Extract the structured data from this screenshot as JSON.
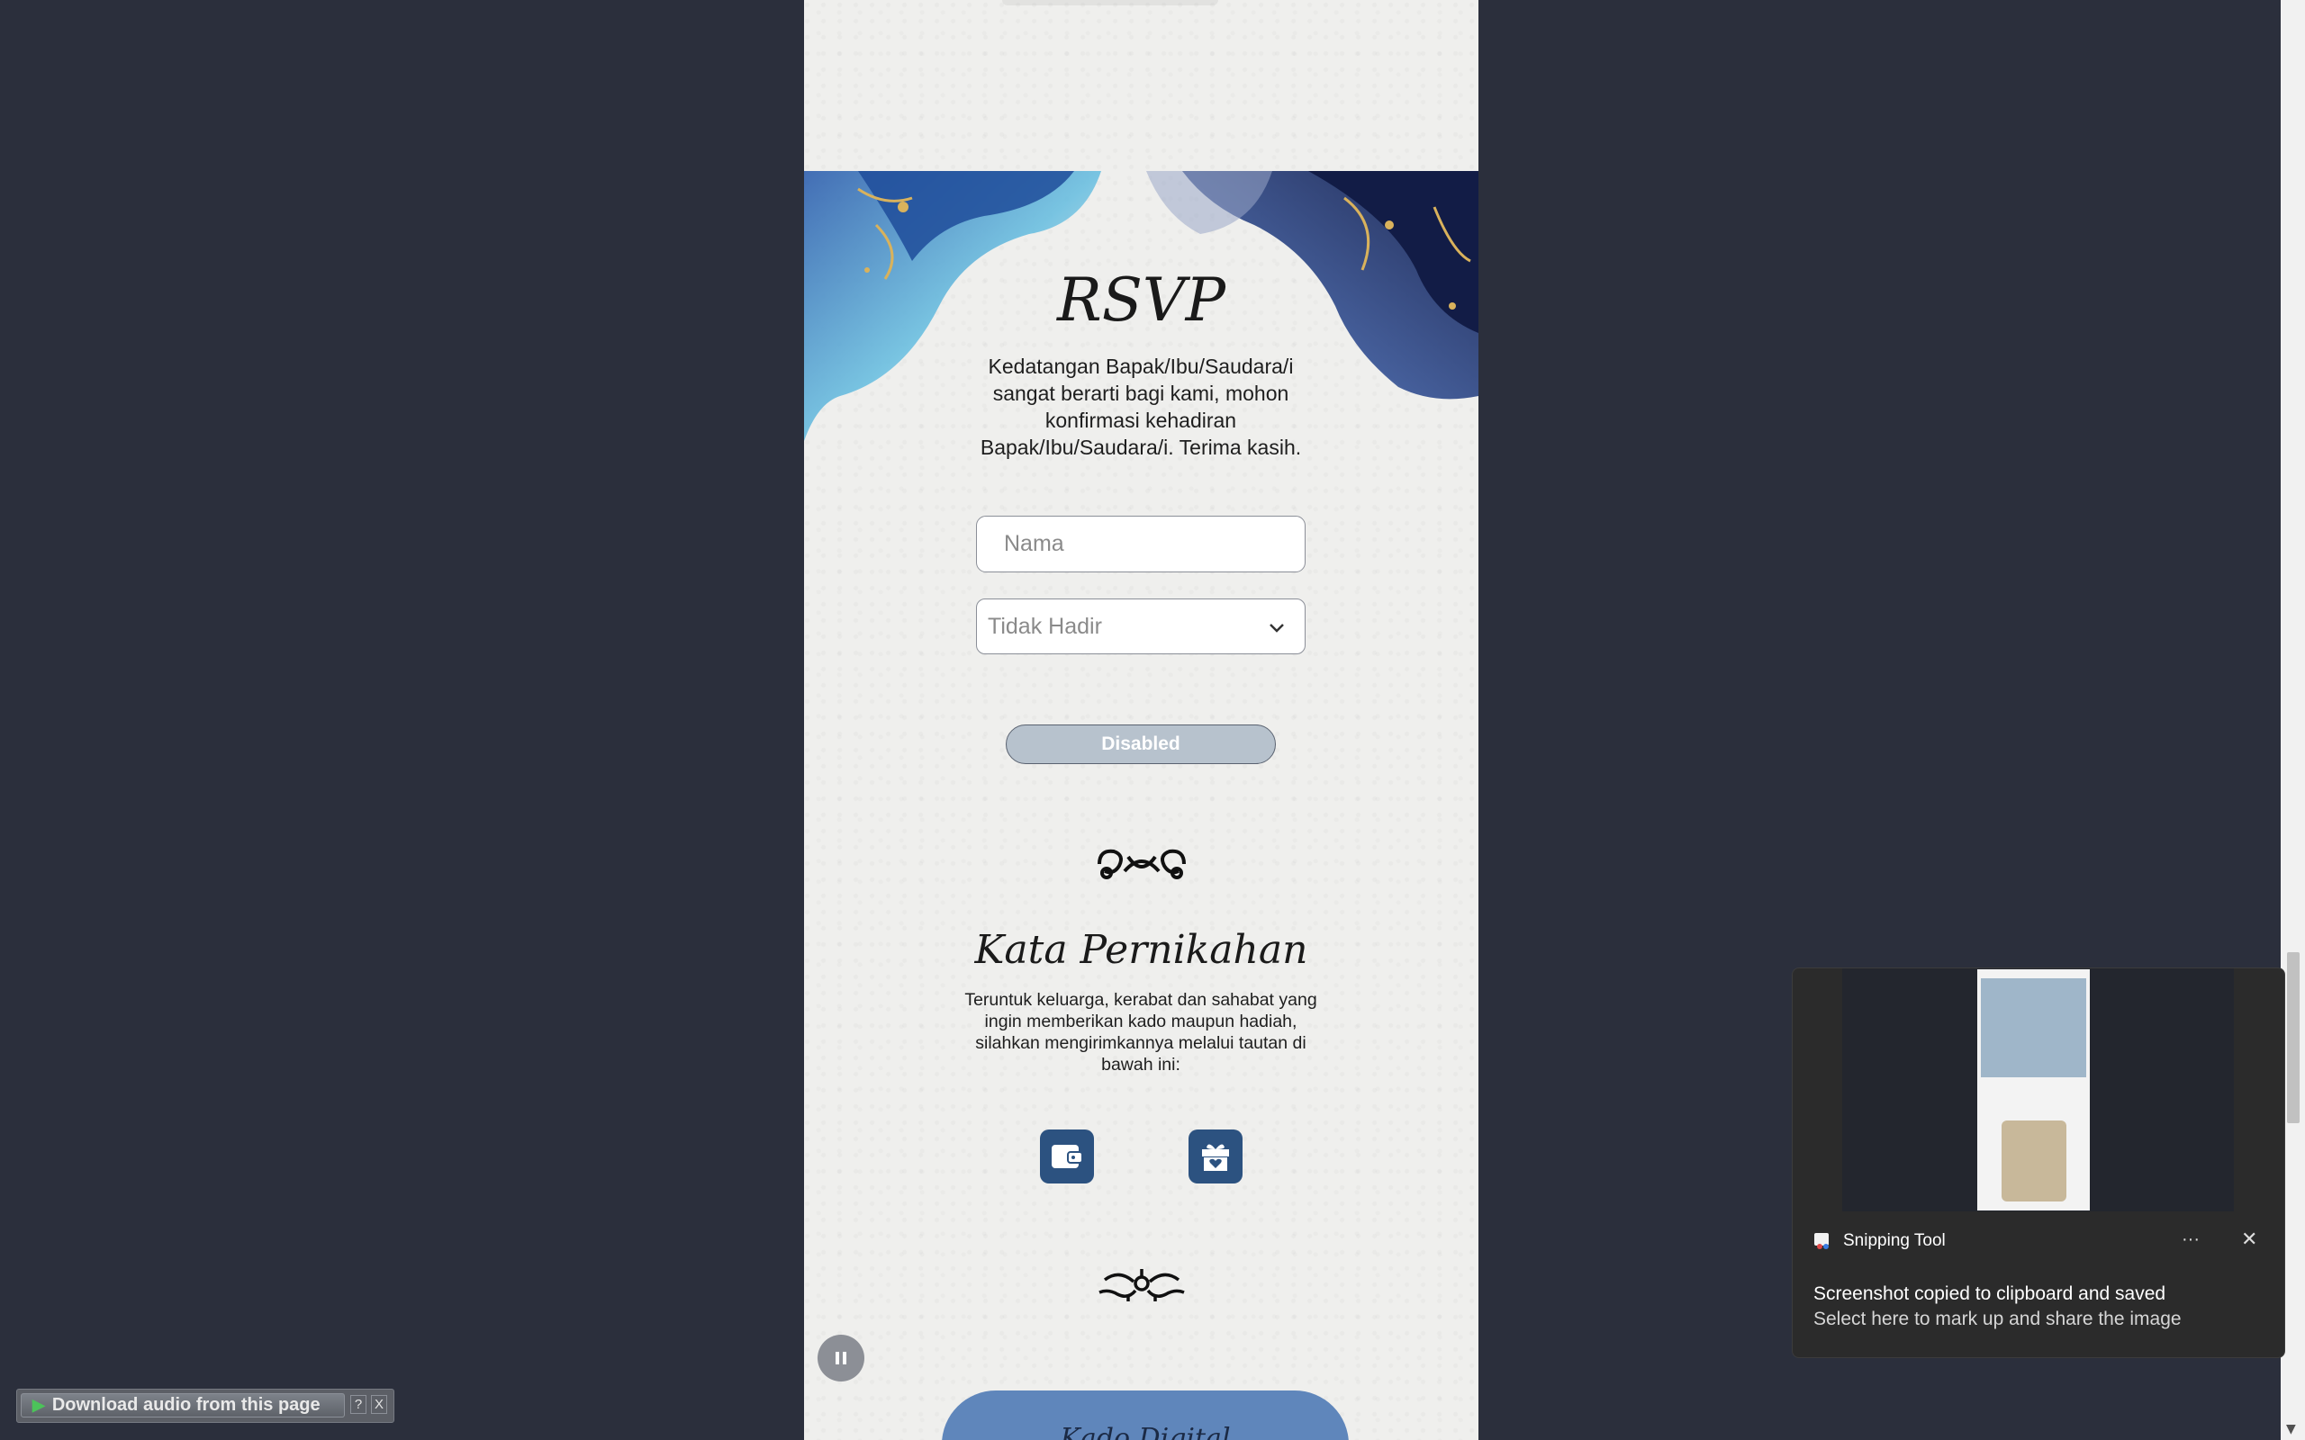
{
  "rsvp": {
    "title": "RSVP",
    "message": "Kedatangan Bapak/Ibu/Saudara/i sangat berarti bagi kami, mohon konfirmasi kehadiran Bapak/Ibu/Saudara/i. Terima kasih.",
    "name_placeholder": "Nama",
    "attendance_selected": "Tidak Hadir",
    "submit_label": "Disabled"
  },
  "gift": {
    "title": "Kata Pernikahan",
    "message": "Teruntuk keluarga, kerabat dan sahabat yang ingin memberikan kado maupun hadiah, silahkan mengirimkannya melalui tautan di bawah ini:",
    "icons": [
      "wallet-icon",
      "gift-icon"
    ]
  },
  "bottom_pill_label": "Kado Digital",
  "snipping_tool": {
    "app_name": "Snipping Tool",
    "title": "Screenshot copied to clipboard and saved",
    "subtitle": "Select here to mark up and share the image"
  },
  "download_bar": {
    "label": "Download audio from this page",
    "help": "?",
    "close": "X"
  },
  "colors": {
    "page_bg": "#2b2f3c",
    "card_bg": "#efefed",
    "icon_button": "#2c5280",
    "pill": "#5f86bb",
    "disabled_button": "#b7c2cd"
  }
}
